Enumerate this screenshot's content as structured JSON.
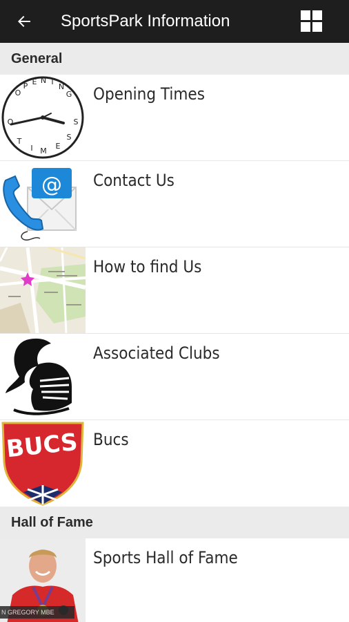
{
  "app_bar": {
    "title": "SportsPark Information",
    "back_icon": "arrow-left-icon",
    "menu_icon": "grid-icon"
  },
  "sections": [
    {
      "header": "General",
      "items": [
        {
          "label": "Opening Times",
          "icon": "clock-icon",
          "clock_text": "OPENING TIMES"
        },
        {
          "label": "Contact Us",
          "icon": "phone-email-icon",
          "email_symbol": "@"
        },
        {
          "label": "How to find Us",
          "icon": "map-icon"
        },
        {
          "label": "Associated Clubs",
          "icon": "knight-helmet-icon"
        },
        {
          "label": "Bucs",
          "icon": "bucs-shield-icon",
          "logo_text": "BUCS"
        }
      ]
    },
    {
      "header": "Hall of Fame",
      "items": [
        {
          "label": "Sports Hall of Fame",
          "icon": "athlete-photo-icon",
          "caption": "N GREGORY MBE"
        }
      ]
    }
  ],
  "colors": {
    "app_bar_bg": "#1e1e1e",
    "section_header_bg": "#ebebeb",
    "bucs_red": "#d6262e",
    "email_blue": "#1e88d8"
  }
}
